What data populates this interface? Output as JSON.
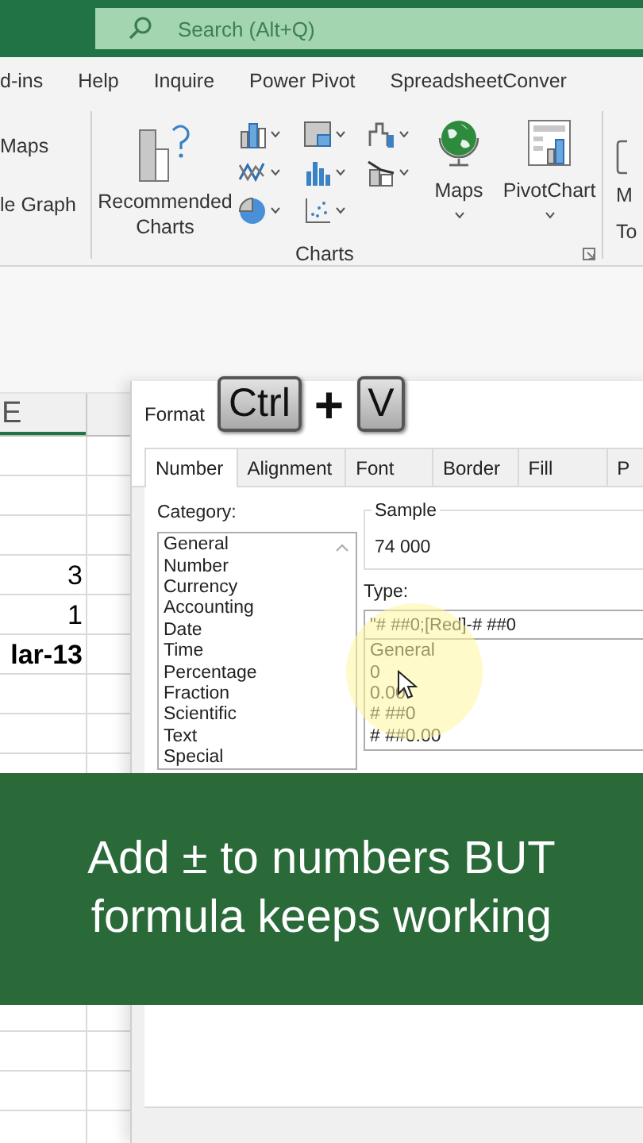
{
  "search": {
    "placeholder": "Search (Alt+Q)"
  },
  "ribbon_tabs": [
    {
      "label": "d-ins"
    },
    {
      "label": "Help"
    },
    {
      "label": "Inquire"
    },
    {
      "label": "Power Pivot"
    },
    {
      "label": "SpreadsheetConver"
    }
  ],
  "ribbon": {
    "left_items": [
      "Maps",
      "le Graph"
    ],
    "recommended": [
      "Recommended",
      "Charts"
    ],
    "chart_buttons": [
      {
        "kind": "column"
      },
      {
        "kind": "hierarchy"
      },
      {
        "kind": "waterfall"
      },
      {
        "kind": "line"
      },
      {
        "kind": "statistic"
      },
      {
        "kind": "combo"
      },
      {
        "kind": "pie"
      },
      {
        "kind": "scatter"
      }
    ],
    "maps": "Maps",
    "pivotchart": "PivotChart",
    "group_label": "Charts",
    "right_partial": [
      "M",
      "To"
    ]
  },
  "sheet": {
    "column_header": "E",
    "rows": [
      {
        "value": "3",
        "bold": false
      },
      {
        "value": "1",
        "bold": false
      },
      {
        "value": "lar-13",
        "bold": true
      }
    ]
  },
  "dialog": {
    "title": "Format",
    "tabs": [
      {
        "label": "Number",
        "selected": true
      },
      {
        "label": "Alignment",
        "selected": false
      },
      {
        "label": "Font",
        "selected": false
      },
      {
        "label": "Border",
        "selected": false
      },
      {
        "label": "Fill",
        "selected": false
      },
      {
        "label": "P",
        "selected": false
      }
    ],
    "category_label": "Category:",
    "categories": [
      {
        "label": "General",
        "selected": false
      },
      {
        "label": "Number",
        "selected": false
      },
      {
        "label": "Currency",
        "selected": false
      },
      {
        "label": "Accounting",
        "selected": false
      },
      {
        "label": "Date",
        "selected": false
      },
      {
        "label": "Time",
        "selected": false
      },
      {
        "label": "Percentage",
        "selected": false
      },
      {
        "label": "Fraction",
        "selected": false
      },
      {
        "label": "Scientific",
        "selected": false
      },
      {
        "label": "Text",
        "selected": false
      },
      {
        "label": "Special",
        "selected": false
      }
    ],
    "sample_label": "Sample",
    "sample_value": "74 000",
    "type_label": "Type:",
    "type_value": "\"# ##0;[Red]-# ##0",
    "type_list": [
      "General",
      "0",
      "0.00",
      "# ##0",
      "# ##0.00"
    ]
  },
  "shortcut": {
    "keys": [
      "Ctrl",
      "V"
    ],
    "joiner": "+"
  },
  "banner": {
    "lines": [
      "Add ± to numbers BUT",
      "formula keeps working"
    ]
  }
}
